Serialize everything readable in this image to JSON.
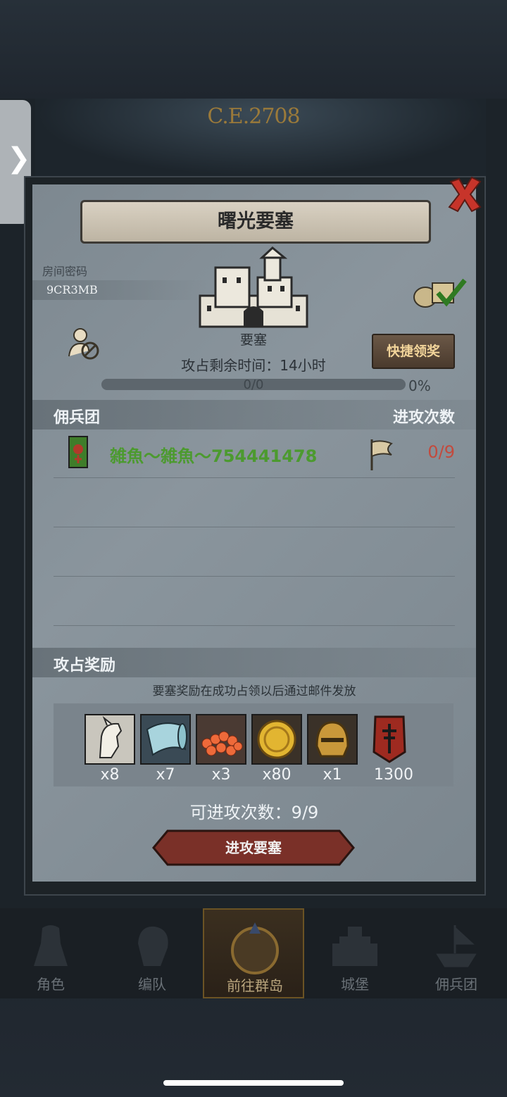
{
  "header": {
    "era_title": "C.E.2708",
    "side_tab_glyph": "❯"
  },
  "dialog": {
    "title": "曙光要塞",
    "room_label": "房间密码",
    "room_code": "9CR3MB",
    "fortress_label": "要塞",
    "time_label": "攻占剩余时间：14小时",
    "quick_claim_label": "快捷领奖",
    "progress": {
      "text": "0/0",
      "percent_text": "0%",
      "fraction": 0
    },
    "merc_section": {
      "left": "佣兵团",
      "right": "进攻次数"
    },
    "mercenaries": [
      {
        "name": "雑魚～雑魚～754441478",
        "count": "0/9"
      }
    ],
    "reward_section": {
      "left": "攻占奖励"
    },
    "reward_note": "要塞奖励在成功占领以后通过邮件发放",
    "rewards": [
      {
        "icon": "horse-icon",
        "count": "x8"
      },
      {
        "icon": "cloth-icon",
        "count": "x7"
      },
      {
        "icon": "roe-icon",
        "count": "x3"
      },
      {
        "icon": "gold-coin-icon",
        "count": "x80"
      },
      {
        "icon": "helmet-icon",
        "count": "x1"
      },
      {
        "icon": "shield-banner-icon",
        "count": "1300"
      }
    ],
    "attempts_label": "可进攻次数：9/9",
    "attack_button": "进攻要塞"
  },
  "nav": {
    "items": [
      {
        "label": "角色"
      },
      {
        "label": "编队"
      },
      {
        "label": "前往群岛"
      },
      {
        "label": "城堡"
      },
      {
        "label": "佣兵团"
      }
    ]
  },
  "colors": {
    "accent_gold": "#f2d49a",
    "merc_green": "#4c9a2f",
    "count_red": "#c34a3d"
  }
}
